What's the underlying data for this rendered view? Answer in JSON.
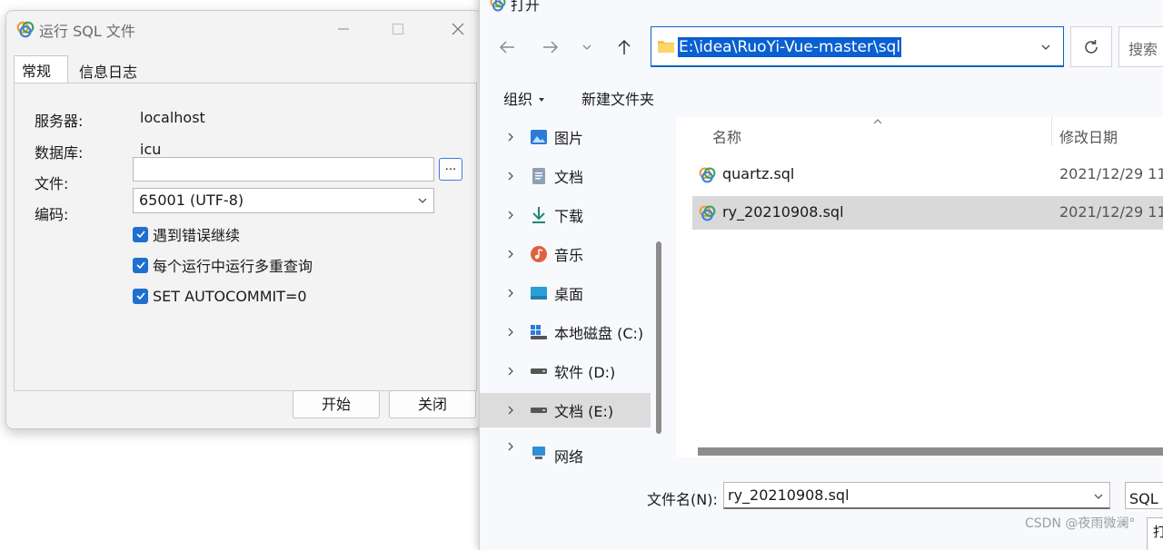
{
  "run_sql_window": {
    "title": "运行 SQL 文件",
    "tabs": [
      {
        "label": "常规",
        "active": true
      },
      {
        "label": "信息日志",
        "active": false
      }
    ],
    "fields": {
      "server_label": "服务器:",
      "server_value": "localhost",
      "database_label": "数据库:",
      "database_value": "icu",
      "file_label": "文件:",
      "file_value": "",
      "browse_label": "...",
      "encoding_label": "编码:",
      "encoding_value": "65001 (UTF-8)"
    },
    "options": [
      {
        "label": "遇到错误继续",
        "checked": true
      },
      {
        "label": "每个运行中运行多重查询",
        "checked": true
      },
      {
        "label": "SET AUTOCOMMIT=0",
        "checked": true
      }
    ],
    "buttons": {
      "start": "开始",
      "close": "关闭"
    }
  },
  "open_dialog": {
    "title": "打开",
    "address": "E:\\idea\\RuoYi-Vue-master\\sql",
    "search_placeholder": "搜索",
    "toolbar": {
      "organize": "组织",
      "new_folder": "新建文件夹"
    },
    "nav_items": [
      {
        "label": "图片",
        "icon": "pictures-icon",
        "selected": false
      },
      {
        "label": "文档",
        "icon": "documents-icon",
        "selected": false
      },
      {
        "label": "下载",
        "icon": "download-icon",
        "selected": false
      },
      {
        "label": "音乐",
        "icon": "music-icon",
        "selected": false
      },
      {
        "label": "桌面",
        "icon": "desktop-icon",
        "selected": false
      },
      {
        "label": "本地磁盘 (C:)",
        "icon": "system-drive-icon",
        "selected": false
      },
      {
        "label": "软件 (D:)",
        "icon": "drive-icon",
        "selected": false
      },
      {
        "label": "文档 (E:)",
        "icon": "drive-icon",
        "selected": true
      },
      {
        "label": "网络",
        "icon": "network-icon",
        "selected": false
      }
    ],
    "columns": {
      "name": "名称",
      "modified": "修改日期"
    },
    "files": [
      {
        "name": "quartz.sql",
        "modified": "2021/12/29 11",
        "selected": false
      },
      {
        "name": "ry_20210908.sql",
        "modified": "2021/12/29 11",
        "selected": true
      }
    ],
    "filename_label": "文件名(N):",
    "filename_value": "ry_20210908.sql",
    "filetype_value": "SQL 文",
    "open_button": "打"
  },
  "watermark": "CSDN @夜雨微澜°",
  "colors": {
    "accent": "#0a5fd1",
    "checkbox": "#1f6fd1",
    "selection": "#d9d9d9"
  }
}
